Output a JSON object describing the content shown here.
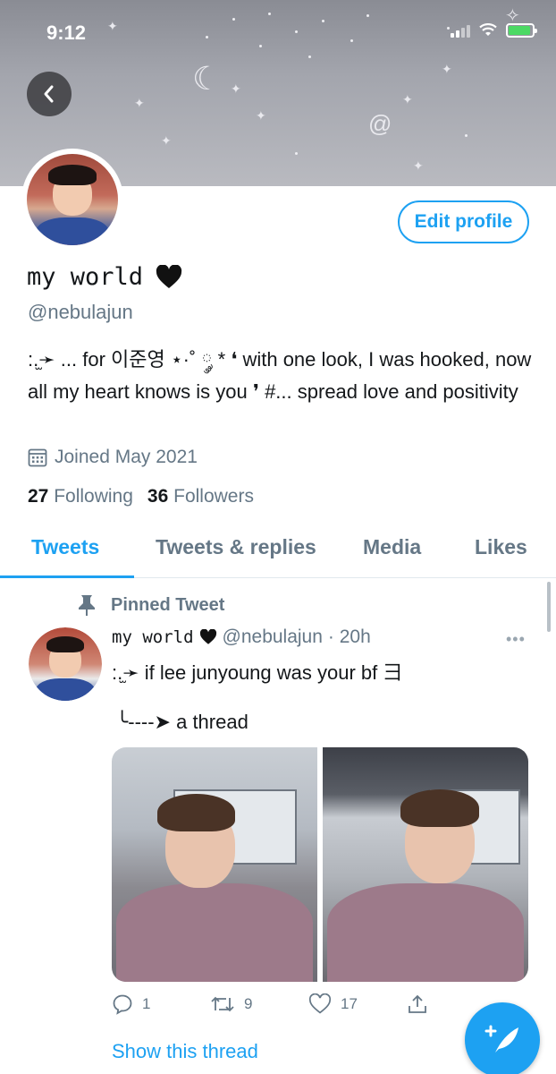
{
  "status_bar": {
    "time": "9:12"
  },
  "profile": {
    "display_name": "my world",
    "handle": "@nebulajun",
    "bio": ":.̫➛ ... for 이준영 ⋆·˚ ༘ * ❛ with one look, I was hooked, now all my heart knows is you ❜ #... spread love and positivity",
    "joined": "Joined May 2021",
    "following_count": "27",
    "following_label": "Following",
    "followers_count": "36",
    "followers_label": "Followers",
    "edit_label": "Edit profile"
  },
  "tabs": [
    {
      "label": "Tweets",
      "active": true
    },
    {
      "label": "Tweets & replies"
    },
    {
      "label": "Media"
    },
    {
      "label": "Likes"
    }
  ],
  "pinned_tweet": {
    "pinned_label": "Pinned Tweet",
    "name": "my world",
    "handle": "@nebulajun",
    "time": "· 20h",
    "line1": ":.̫➛ if lee junyoung was your bf ⺕",
    "line2": "╰----➤ a thread",
    "replies": "1",
    "retweets": "9",
    "likes": "17",
    "show_thread": "Show this thread"
  },
  "colors": {
    "accent": "#1da1f2",
    "muted": "#657786",
    "text": "#14171a"
  },
  "icons": [
    "back-arrow-icon",
    "calendar-icon",
    "pin-icon",
    "heart-icon",
    "more-icon",
    "reply-icon",
    "retweet-icon",
    "like-icon",
    "share-icon",
    "compose-icon"
  ]
}
